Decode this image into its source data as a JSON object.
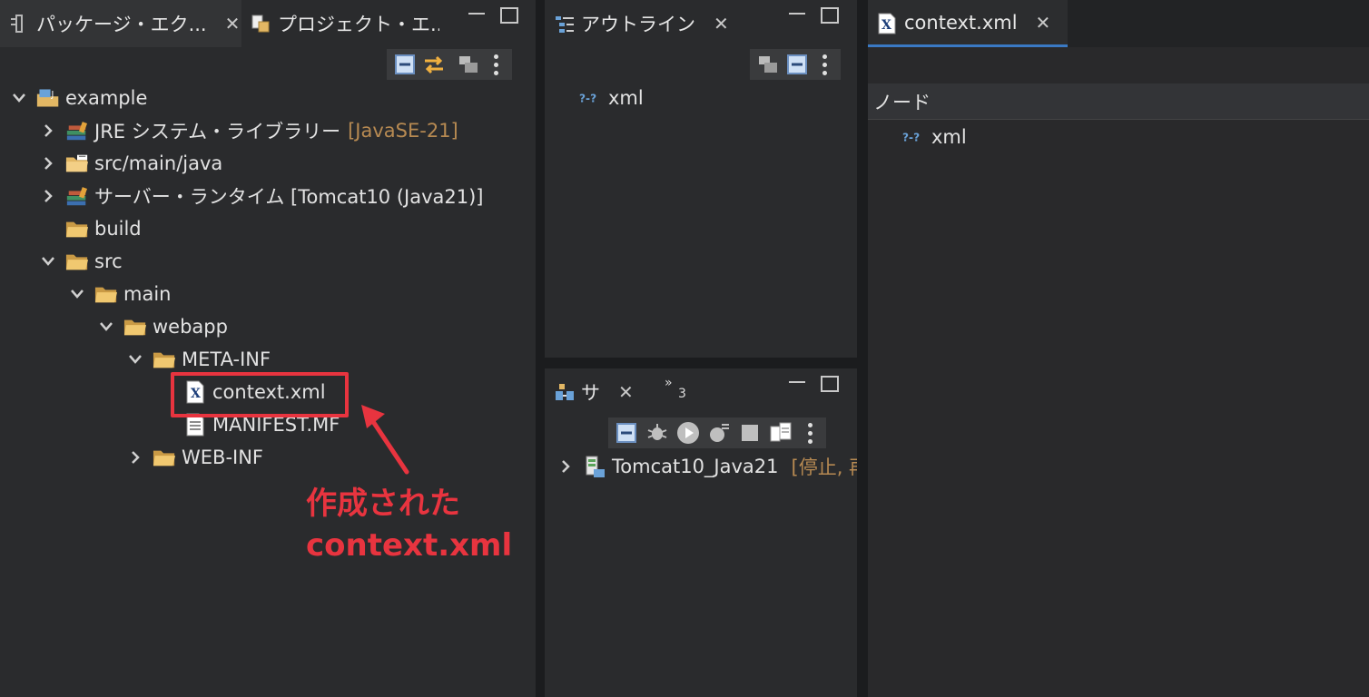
{
  "left_panel": {
    "tabs": [
      {
        "label": "パッケージ・エク..."
      },
      {
        "label": "プロジェクト・エ..."
      }
    ],
    "tree": [
      {
        "label": "example",
        "icon": "project-icon",
        "expanded": true
      },
      {
        "label": "JRE システム・ライブラリー",
        "decoration": "[JavaSE-21]",
        "icon": "library-icon"
      },
      {
        "label": "src/main/java",
        "icon": "source-folder-icon"
      },
      {
        "label": "サーバー・ランタイム [Tomcat10 (Java21)]",
        "icon": "library-icon"
      },
      {
        "label": "build",
        "icon": "folder-icon"
      },
      {
        "label": "src",
        "icon": "folder-icon",
        "expanded": true
      },
      {
        "label": "main",
        "icon": "folder-icon",
        "expanded": true
      },
      {
        "label": "webapp",
        "icon": "folder-icon",
        "expanded": true
      },
      {
        "label": "META-INF",
        "icon": "folder-icon",
        "expanded": true
      },
      {
        "label": "context.xml",
        "icon": "xml-file-icon"
      },
      {
        "label": "MANIFEST.MF",
        "icon": "text-file-icon"
      },
      {
        "label": "WEB-INF",
        "icon": "folder-icon"
      }
    ]
  },
  "outline_panel": {
    "tab_label": "アウトライン",
    "items": [
      {
        "label": "xml",
        "icon": "xml-declaration-icon"
      }
    ]
  },
  "servers_panel": {
    "tab_label": "サ",
    "overflow_count": "3",
    "items": [
      {
        "label": "Tomcat10_Java21",
        "status": "[停止, 再"
      }
    ]
  },
  "editor_panel": {
    "tab_label": "context.xml",
    "column_header": "ノード",
    "nodes": [
      {
        "label": "xml",
        "icon": "xml-declaration-icon"
      }
    ]
  },
  "annotation": {
    "line1": "作成された",
    "line2": "context.xml",
    "color": "#e8343f"
  },
  "colors": {
    "folder": "#e2b764",
    "accent": "#3a79c4",
    "decoration": "#b78a52"
  }
}
